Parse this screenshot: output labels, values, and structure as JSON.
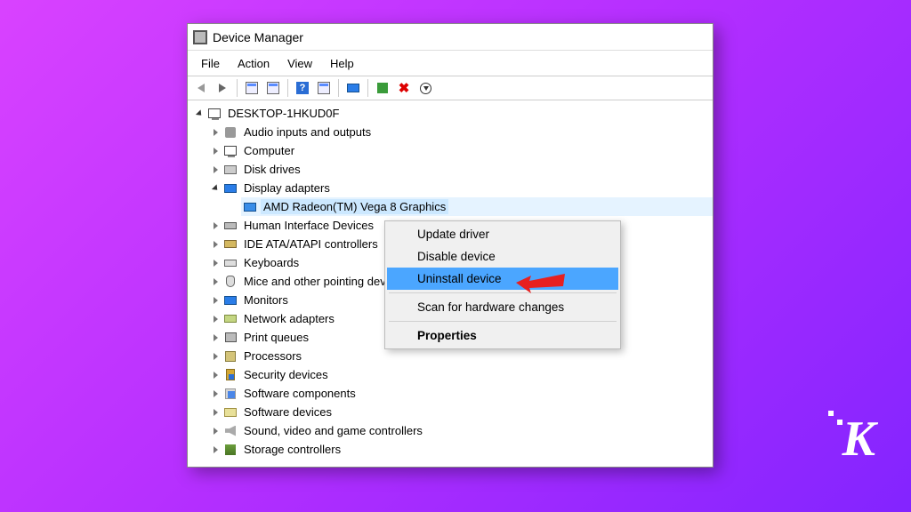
{
  "window": {
    "title": "Device Manager"
  },
  "menubar": {
    "file": "File",
    "action": "Action",
    "view": "View",
    "help": "Help"
  },
  "tree": {
    "root": "DESKTOP-1HKUD0F",
    "audio": "Audio inputs and outputs",
    "computer": "Computer",
    "disk": "Disk drives",
    "display": "Display adapters",
    "gpu": "AMD Radeon(TM) Vega 8 Graphics",
    "hid": "Human Interface Devices",
    "ide": "IDE ATA/ATAPI controllers",
    "kbd": "Keyboards",
    "mouse": "Mice and other pointing devices",
    "monitor": "Monitors",
    "net": "Network adapters",
    "print": "Print queues",
    "cpu": "Processors",
    "sec": "Security devices",
    "swc": "Software components",
    "swd": "Software devices",
    "snd": "Sound, video and game controllers",
    "stor": "Storage controllers"
  },
  "context_menu": {
    "update": "Update driver",
    "disable": "Disable device",
    "uninstall": "Uninstall device",
    "scan": "Scan for hardware changes",
    "properties": "Properties"
  }
}
